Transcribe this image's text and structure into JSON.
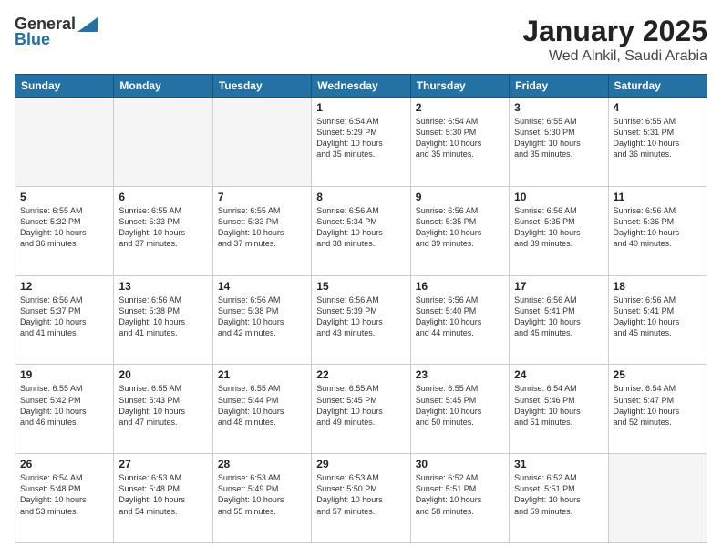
{
  "header": {
    "logo_general": "General",
    "logo_blue": "Blue",
    "month_title": "January 2025",
    "location": "Wed Alnkil, Saudi Arabia"
  },
  "days_of_week": [
    "Sunday",
    "Monday",
    "Tuesday",
    "Wednesday",
    "Thursday",
    "Friday",
    "Saturday"
  ],
  "weeks": [
    [
      {
        "day": "",
        "info": ""
      },
      {
        "day": "",
        "info": ""
      },
      {
        "day": "",
        "info": ""
      },
      {
        "day": "1",
        "info": "Sunrise: 6:54 AM\nSunset: 5:29 PM\nDaylight: 10 hours\nand 35 minutes."
      },
      {
        "day": "2",
        "info": "Sunrise: 6:54 AM\nSunset: 5:30 PM\nDaylight: 10 hours\nand 35 minutes."
      },
      {
        "day": "3",
        "info": "Sunrise: 6:55 AM\nSunset: 5:30 PM\nDaylight: 10 hours\nand 35 minutes."
      },
      {
        "day": "4",
        "info": "Sunrise: 6:55 AM\nSunset: 5:31 PM\nDaylight: 10 hours\nand 36 minutes."
      }
    ],
    [
      {
        "day": "5",
        "info": "Sunrise: 6:55 AM\nSunset: 5:32 PM\nDaylight: 10 hours\nand 36 minutes."
      },
      {
        "day": "6",
        "info": "Sunrise: 6:55 AM\nSunset: 5:33 PM\nDaylight: 10 hours\nand 37 minutes."
      },
      {
        "day": "7",
        "info": "Sunrise: 6:55 AM\nSunset: 5:33 PM\nDaylight: 10 hours\nand 37 minutes."
      },
      {
        "day": "8",
        "info": "Sunrise: 6:56 AM\nSunset: 5:34 PM\nDaylight: 10 hours\nand 38 minutes."
      },
      {
        "day": "9",
        "info": "Sunrise: 6:56 AM\nSunset: 5:35 PM\nDaylight: 10 hours\nand 39 minutes."
      },
      {
        "day": "10",
        "info": "Sunrise: 6:56 AM\nSunset: 5:35 PM\nDaylight: 10 hours\nand 39 minutes."
      },
      {
        "day": "11",
        "info": "Sunrise: 6:56 AM\nSunset: 5:36 PM\nDaylight: 10 hours\nand 40 minutes."
      }
    ],
    [
      {
        "day": "12",
        "info": "Sunrise: 6:56 AM\nSunset: 5:37 PM\nDaylight: 10 hours\nand 41 minutes."
      },
      {
        "day": "13",
        "info": "Sunrise: 6:56 AM\nSunset: 5:38 PM\nDaylight: 10 hours\nand 41 minutes."
      },
      {
        "day": "14",
        "info": "Sunrise: 6:56 AM\nSunset: 5:38 PM\nDaylight: 10 hours\nand 42 minutes."
      },
      {
        "day": "15",
        "info": "Sunrise: 6:56 AM\nSunset: 5:39 PM\nDaylight: 10 hours\nand 43 minutes."
      },
      {
        "day": "16",
        "info": "Sunrise: 6:56 AM\nSunset: 5:40 PM\nDaylight: 10 hours\nand 44 minutes."
      },
      {
        "day": "17",
        "info": "Sunrise: 6:56 AM\nSunset: 5:41 PM\nDaylight: 10 hours\nand 45 minutes."
      },
      {
        "day": "18",
        "info": "Sunrise: 6:56 AM\nSunset: 5:41 PM\nDaylight: 10 hours\nand 45 minutes."
      }
    ],
    [
      {
        "day": "19",
        "info": "Sunrise: 6:55 AM\nSunset: 5:42 PM\nDaylight: 10 hours\nand 46 minutes."
      },
      {
        "day": "20",
        "info": "Sunrise: 6:55 AM\nSunset: 5:43 PM\nDaylight: 10 hours\nand 47 minutes."
      },
      {
        "day": "21",
        "info": "Sunrise: 6:55 AM\nSunset: 5:44 PM\nDaylight: 10 hours\nand 48 minutes."
      },
      {
        "day": "22",
        "info": "Sunrise: 6:55 AM\nSunset: 5:45 PM\nDaylight: 10 hours\nand 49 minutes."
      },
      {
        "day": "23",
        "info": "Sunrise: 6:55 AM\nSunset: 5:45 PM\nDaylight: 10 hours\nand 50 minutes."
      },
      {
        "day": "24",
        "info": "Sunrise: 6:54 AM\nSunset: 5:46 PM\nDaylight: 10 hours\nand 51 minutes."
      },
      {
        "day": "25",
        "info": "Sunrise: 6:54 AM\nSunset: 5:47 PM\nDaylight: 10 hours\nand 52 minutes."
      }
    ],
    [
      {
        "day": "26",
        "info": "Sunrise: 6:54 AM\nSunset: 5:48 PM\nDaylight: 10 hours\nand 53 minutes."
      },
      {
        "day": "27",
        "info": "Sunrise: 6:53 AM\nSunset: 5:48 PM\nDaylight: 10 hours\nand 54 minutes."
      },
      {
        "day": "28",
        "info": "Sunrise: 6:53 AM\nSunset: 5:49 PM\nDaylight: 10 hours\nand 55 minutes."
      },
      {
        "day": "29",
        "info": "Sunrise: 6:53 AM\nSunset: 5:50 PM\nDaylight: 10 hours\nand 57 minutes."
      },
      {
        "day": "30",
        "info": "Sunrise: 6:52 AM\nSunset: 5:51 PM\nDaylight: 10 hours\nand 58 minutes."
      },
      {
        "day": "31",
        "info": "Sunrise: 6:52 AM\nSunset: 5:51 PM\nDaylight: 10 hours\nand 59 minutes."
      },
      {
        "day": "",
        "info": ""
      }
    ]
  ]
}
